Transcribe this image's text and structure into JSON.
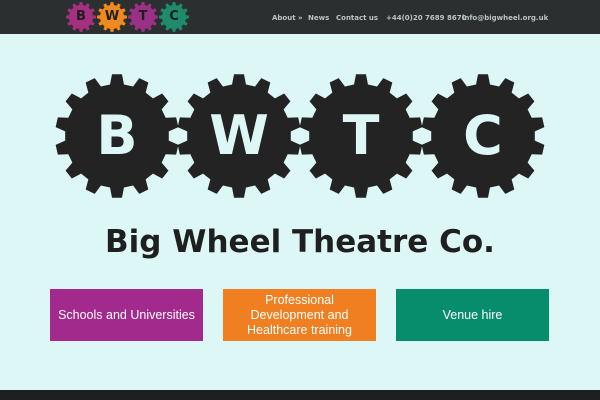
{
  "header": {
    "logo": {
      "label": "BWTC logo",
      "gears": [
        {
          "letter": "B",
          "color": "#a4307f"
        },
        {
          "letter": "W",
          "color": "#f18a1d"
        },
        {
          "letter": "T",
          "color": "#9b3186"
        },
        {
          "letter": "C",
          "color": "#1f8a6c"
        }
      ]
    },
    "nav": {
      "about": "About »",
      "news": "News",
      "contact": "Contact us",
      "phone": "+44(0)20 7689 8670",
      "email": "info@bigwheel.org.uk"
    }
  },
  "hero": {
    "gear_letters": [
      "B",
      "W",
      "T",
      "C"
    ],
    "company_name": "Big Wheel Theatre Co."
  },
  "cta_buttons": [
    {
      "label": "Schools and Universities",
      "color": "#a22a8c"
    },
    {
      "label": "Professional Development and Healthcare training",
      "color": "#f07f22"
    },
    {
      "label": "Venue hire",
      "color": "#078d6b"
    }
  ],
  "colors": {
    "page_background": "#dcf7f6",
    "header_background": "#2b2f2f",
    "gear_fill": "#232323",
    "footer_background": "#1d2020"
  }
}
